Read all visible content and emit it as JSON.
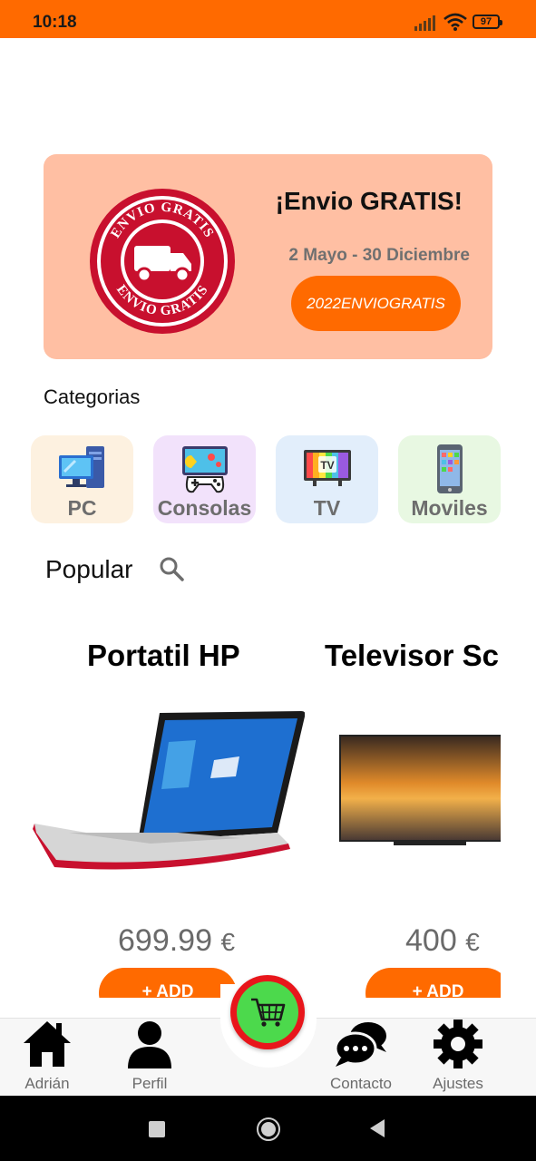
{
  "status_bar": {
    "time": "10:18",
    "battery": "97"
  },
  "promo": {
    "stamp_text": "ENVIO GRATIS",
    "title": "¡Envio GRATIS!",
    "dates": "2 Mayo - 30 Diciembre",
    "code": "2022ENVIOGRATIS"
  },
  "categories": {
    "title": "Categorias",
    "items": [
      {
        "label": "PC",
        "bg": "#fdf1e0"
      },
      {
        "label": "Consolas",
        "bg": "#f2e2fb"
      },
      {
        "label": "TV",
        "bg": "#e2eefb"
      },
      {
        "label": "Moviles",
        "bg": "#e8f8e2"
      }
    ]
  },
  "popular": {
    "title": "Popular",
    "products": [
      {
        "name": "Portatil HP",
        "price": "699.99",
        "currency": "€",
        "add_label": "+ ADD"
      },
      {
        "name": "Televisor Sc",
        "price": "400",
        "currency": "€",
        "add_label": "+ ADD"
      }
    ]
  },
  "bottom_nav": {
    "items": [
      {
        "label": "Adrián",
        "icon": "home-icon"
      },
      {
        "label": "Perfil",
        "icon": "person-icon"
      },
      {
        "label": "Contacto",
        "icon": "chat-icon"
      },
      {
        "label": "Ajustes",
        "icon": "gear-icon"
      }
    ],
    "cart_icon": "shopping-basket-icon"
  },
  "colors": {
    "accent": "#ff6a00",
    "banner": "#ffbfa3",
    "cart_ring": "#e8161b",
    "cart_fill": "#4cd94c"
  }
}
